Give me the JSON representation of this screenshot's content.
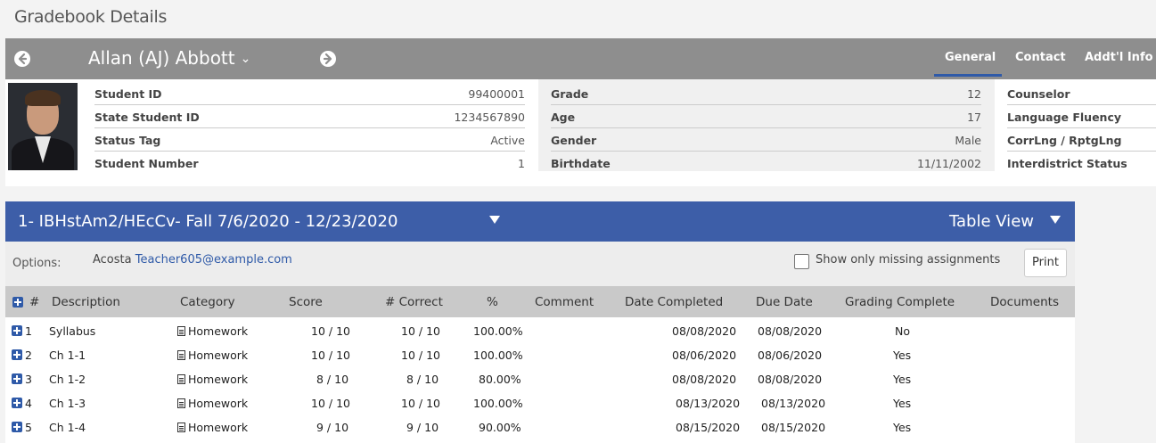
{
  "page": {
    "title": "Gradebook Details"
  },
  "student": {
    "name": "Allan (AJ) Abbott",
    "caret": "⌄",
    "tabs": [
      "General",
      "Contact",
      "Addt'l Info"
    ],
    "col1": [
      {
        "label": "Student ID",
        "value": "99400001"
      },
      {
        "label": "State Student ID",
        "value": "1234567890"
      },
      {
        "label": "Status Tag",
        "value": "Active"
      },
      {
        "label": "Student Number",
        "value": "1"
      }
    ],
    "col2": [
      {
        "label": "Grade",
        "value": "12"
      },
      {
        "label": "Age",
        "value": "17"
      },
      {
        "label": "Gender",
        "value": "Male"
      },
      {
        "label": "Birthdate",
        "value": "11/11/2002"
      }
    ],
    "col3": [
      {
        "label": "Counselor",
        "value": ""
      },
      {
        "label": "Language Fluency",
        "value": ""
      },
      {
        "label": "CorrLng / RptgLng",
        "value": ""
      },
      {
        "label": "Interdistrict Status",
        "value": ""
      }
    ]
  },
  "course": {
    "title": "1- IBHstAm2/HEcCv- Fall 7/6/2020 - 12/23/2020",
    "view": "Table View"
  },
  "options": {
    "label": "Options:",
    "teacher_name": "Acosta",
    "teacher_email": "Teacher605@example.com",
    "missing_only_label": "Show only missing assignments",
    "missing_only_checked": false,
    "print_label": "Print"
  },
  "grid": {
    "columns": [
      "#",
      "Description",
      "Category",
      "Score",
      "# Correct",
      "%",
      "Comment",
      "Date Completed",
      "Due Date",
      "Grading Complete",
      "Documents"
    ],
    "rows": [
      {
        "num": "1",
        "description": "Syllabus",
        "category": "Homework",
        "score": "10 / 10",
        "correct": "10 / 10",
        "percent": "100.00%",
        "comment": "",
        "date_completed": "08/08/2020",
        "due_date": "08/08/2020",
        "grading_complete": "No",
        "documents": ""
      },
      {
        "num": "2",
        "description": "Ch 1-1",
        "category": "Homework",
        "score": "10 / 10",
        "correct": "10 / 10",
        "percent": "100.00%",
        "comment": "",
        "date_completed": "08/06/2020",
        "due_date": "08/06/2020",
        "grading_complete": "Yes",
        "documents": ""
      },
      {
        "num": "3",
        "description": "Ch 1-2",
        "category": "Homework",
        "score": "8 / 10",
        "correct": "8 / 10",
        "percent": "80.00%",
        "comment": "",
        "date_completed": "08/08/2020",
        "due_date": "08/08/2020",
        "grading_complete": "Yes",
        "documents": ""
      },
      {
        "num": "4",
        "description": "Ch 1-3",
        "category": "Homework",
        "score": "10 / 10",
        "correct": "10 / 10",
        "percent": "100.00%",
        "comment": "",
        "date_completed": "08/13/2020",
        "due_date": "08/13/2020",
        "grading_complete": "Yes",
        "documents": ""
      },
      {
        "num": "5",
        "description": "Ch 1-4",
        "category": "Homework",
        "score": "9 / 10",
        "correct": "9 / 10",
        "percent": "90.00%",
        "comment": "",
        "date_completed": "08/15/2020",
        "due_date": "08/15/2020",
        "grading_complete": "Yes",
        "documents": ""
      }
    ]
  },
  "colors": {
    "accent": "#3d5ea8",
    "header_bar": "#8e8e8e",
    "link": "#2f5aa8"
  },
  "icons": {
    "prev": "arrow-left-circle-icon",
    "next": "arrow-right-circle-icon",
    "expand": "plus-square-icon",
    "document": "document-icon"
  }
}
